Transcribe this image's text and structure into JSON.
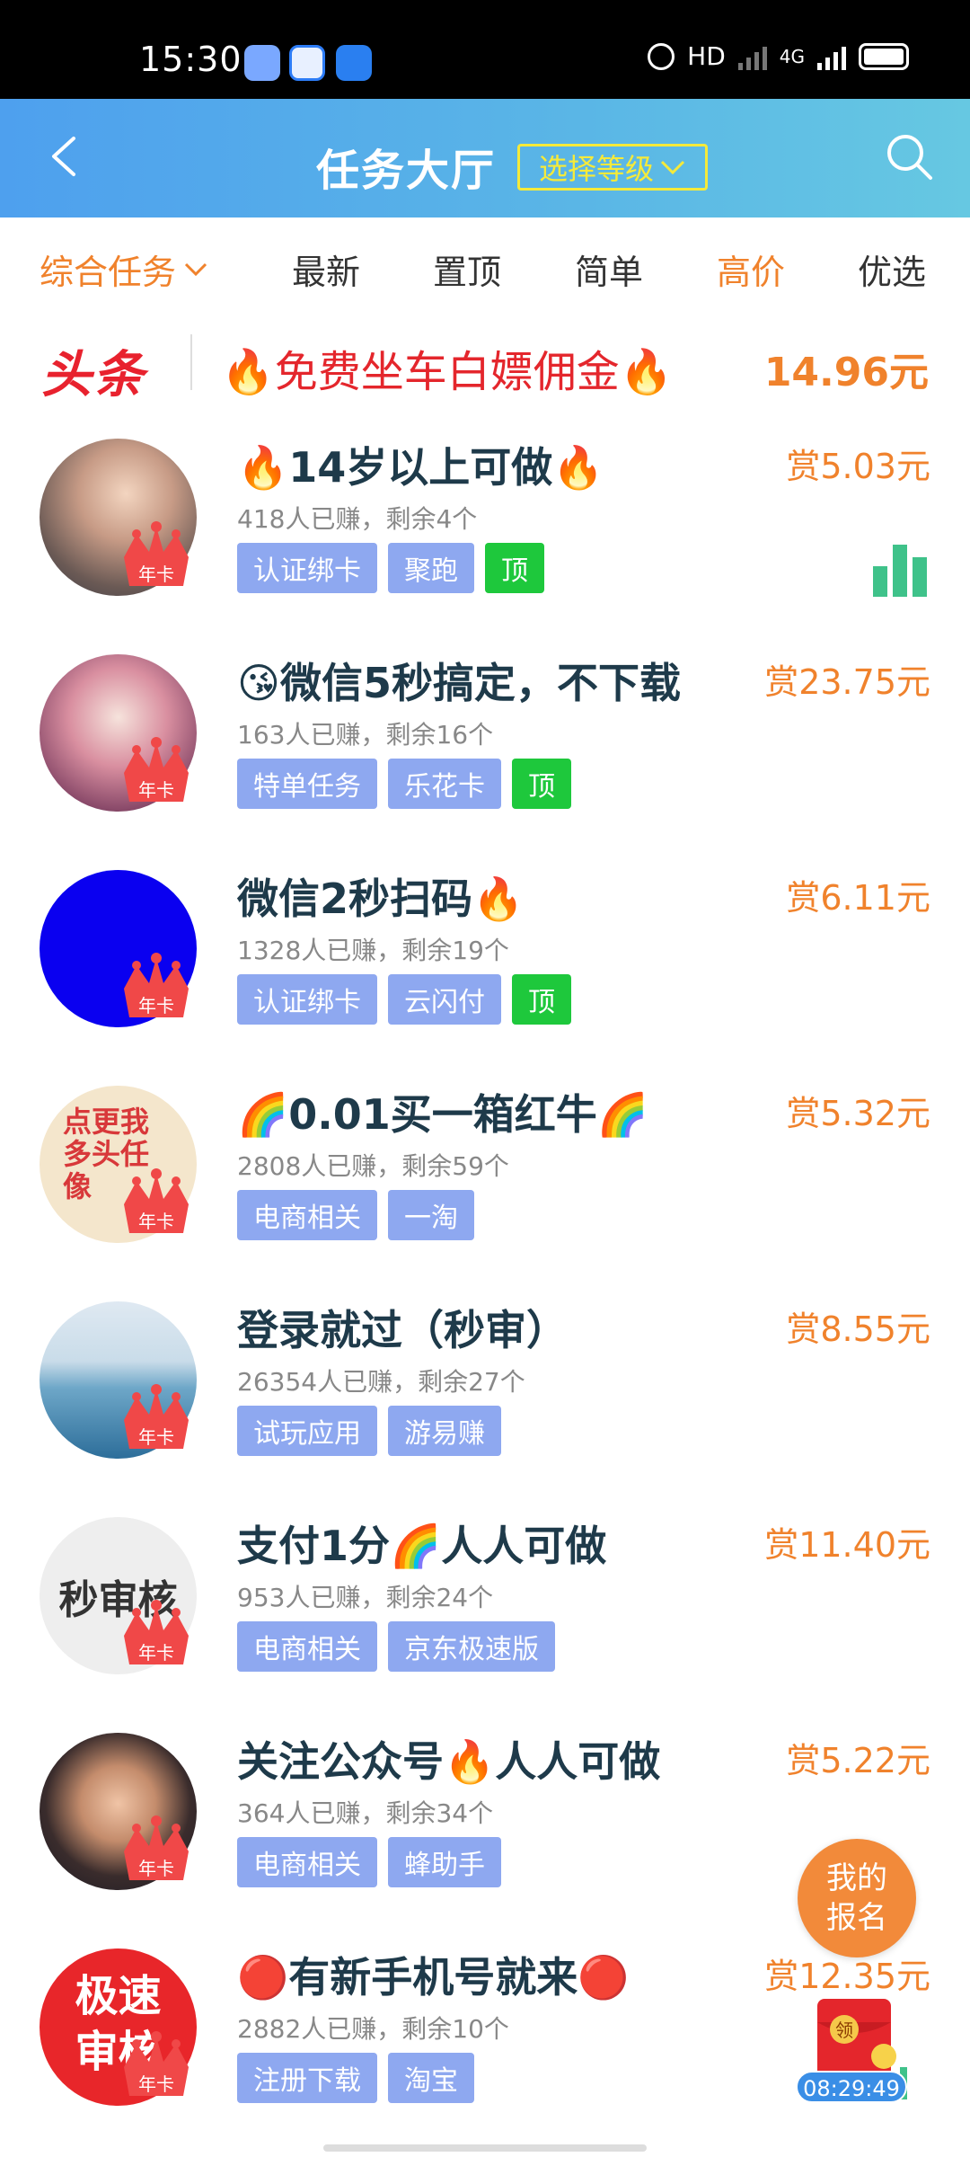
{
  "status_bar": {
    "time": "15:30",
    "network": "HD",
    "network_sub": "4G"
  },
  "header": {
    "title": "任务大厅",
    "level_button": "选择等级"
  },
  "tabs": [
    {
      "label": "综合任务",
      "color": "#f0822c"
    },
    {
      "label": "最新"
    },
    {
      "label": "置顶"
    },
    {
      "label": "简单"
    },
    {
      "label": "高价",
      "color": "#f0822c"
    },
    {
      "label": "优选"
    }
  ],
  "headline": {
    "badge": "头条",
    "text": "🔥免费坐车白嫖佣金🔥",
    "price": "14.96元"
  },
  "tasks": [
    {
      "title": "🔥14岁以上可做🔥",
      "stats": "418人已赚，剩余4个",
      "reward": "赏5.03元",
      "tags": [
        "认证绑卡",
        "聚跑",
        "顶"
      ],
      "crown": "年卡"
    },
    {
      "title": "😘微信5秒搞定，不下载",
      "stats": "163人已赚，剩余16个",
      "reward": "赏23.75元",
      "tags": [
        "特单任务",
        "乐花卡",
        "顶"
      ],
      "crown": "年卡"
    },
    {
      "title": "微信2秒扫码🔥",
      "stats": "1328人已赚，剩余19个",
      "reward": "赏6.11元",
      "tags": [
        "认证绑卡",
        "云闪付",
        "顶"
      ],
      "crown": "年卡"
    },
    {
      "title": "🌈0.01买一箱红牛🌈",
      "stats": "2808人已赚，剩余59个",
      "reward": "赏5.32元",
      "tags": [
        "电商相关",
        "一淘"
      ],
      "crown": "年卡",
      "avatar_text": "点更我多头任像"
    },
    {
      "title": "登录就过（秒审）",
      "stats": "26354人已赚，剩余27个",
      "reward": "赏8.55元",
      "tags": [
        "试玩应用",
        "游易赚"
      ],
      "crown": "年卡"
    },
    {
      "title": "支付1分🌈人人可做",
      "stats": "953人已赚，剩余24个",
      "reward": "赏11.40元",
      "tags": [
        "电商相关",
        "京东极速版"
      ],
      "crown": "年卡",
      "avatar_text": "秒审核"
    },
    {
      "title": "关注公众号🔥人人可做",
      "stats": "364人已赚，剩余34个",
      "reward": "赏5.22元",
      "tags": [
        "电商相关",
        "蜂助手"
      ],
      "crown": "年卡"
    },
    {
      "title": "🔴有新手机号就来🔴",
      "stats": "2882人已赚，剩余10个",
      "reward": "赏12.35元",
      "tags": [
        "注册下载",
        "淘宝"
      ],
      "crown": "年卡",
      "avatar_text_line1": "极速",
      "avatar_text_line2": "审核"
    }
  ],
  "floating": {
    "my_signup": "我的报名",
    "redpacket_label": "领",
    "timer": "08:29:49"
  },
  "colors": {
    "accent_orange": "#f0822c",
    "tag_blue": "#8ea8f0",
    "tag_green": "#1ec83c",
    "header_start": "#4ea0ee",
    "header_end": "#66c8e2"
  }
}
